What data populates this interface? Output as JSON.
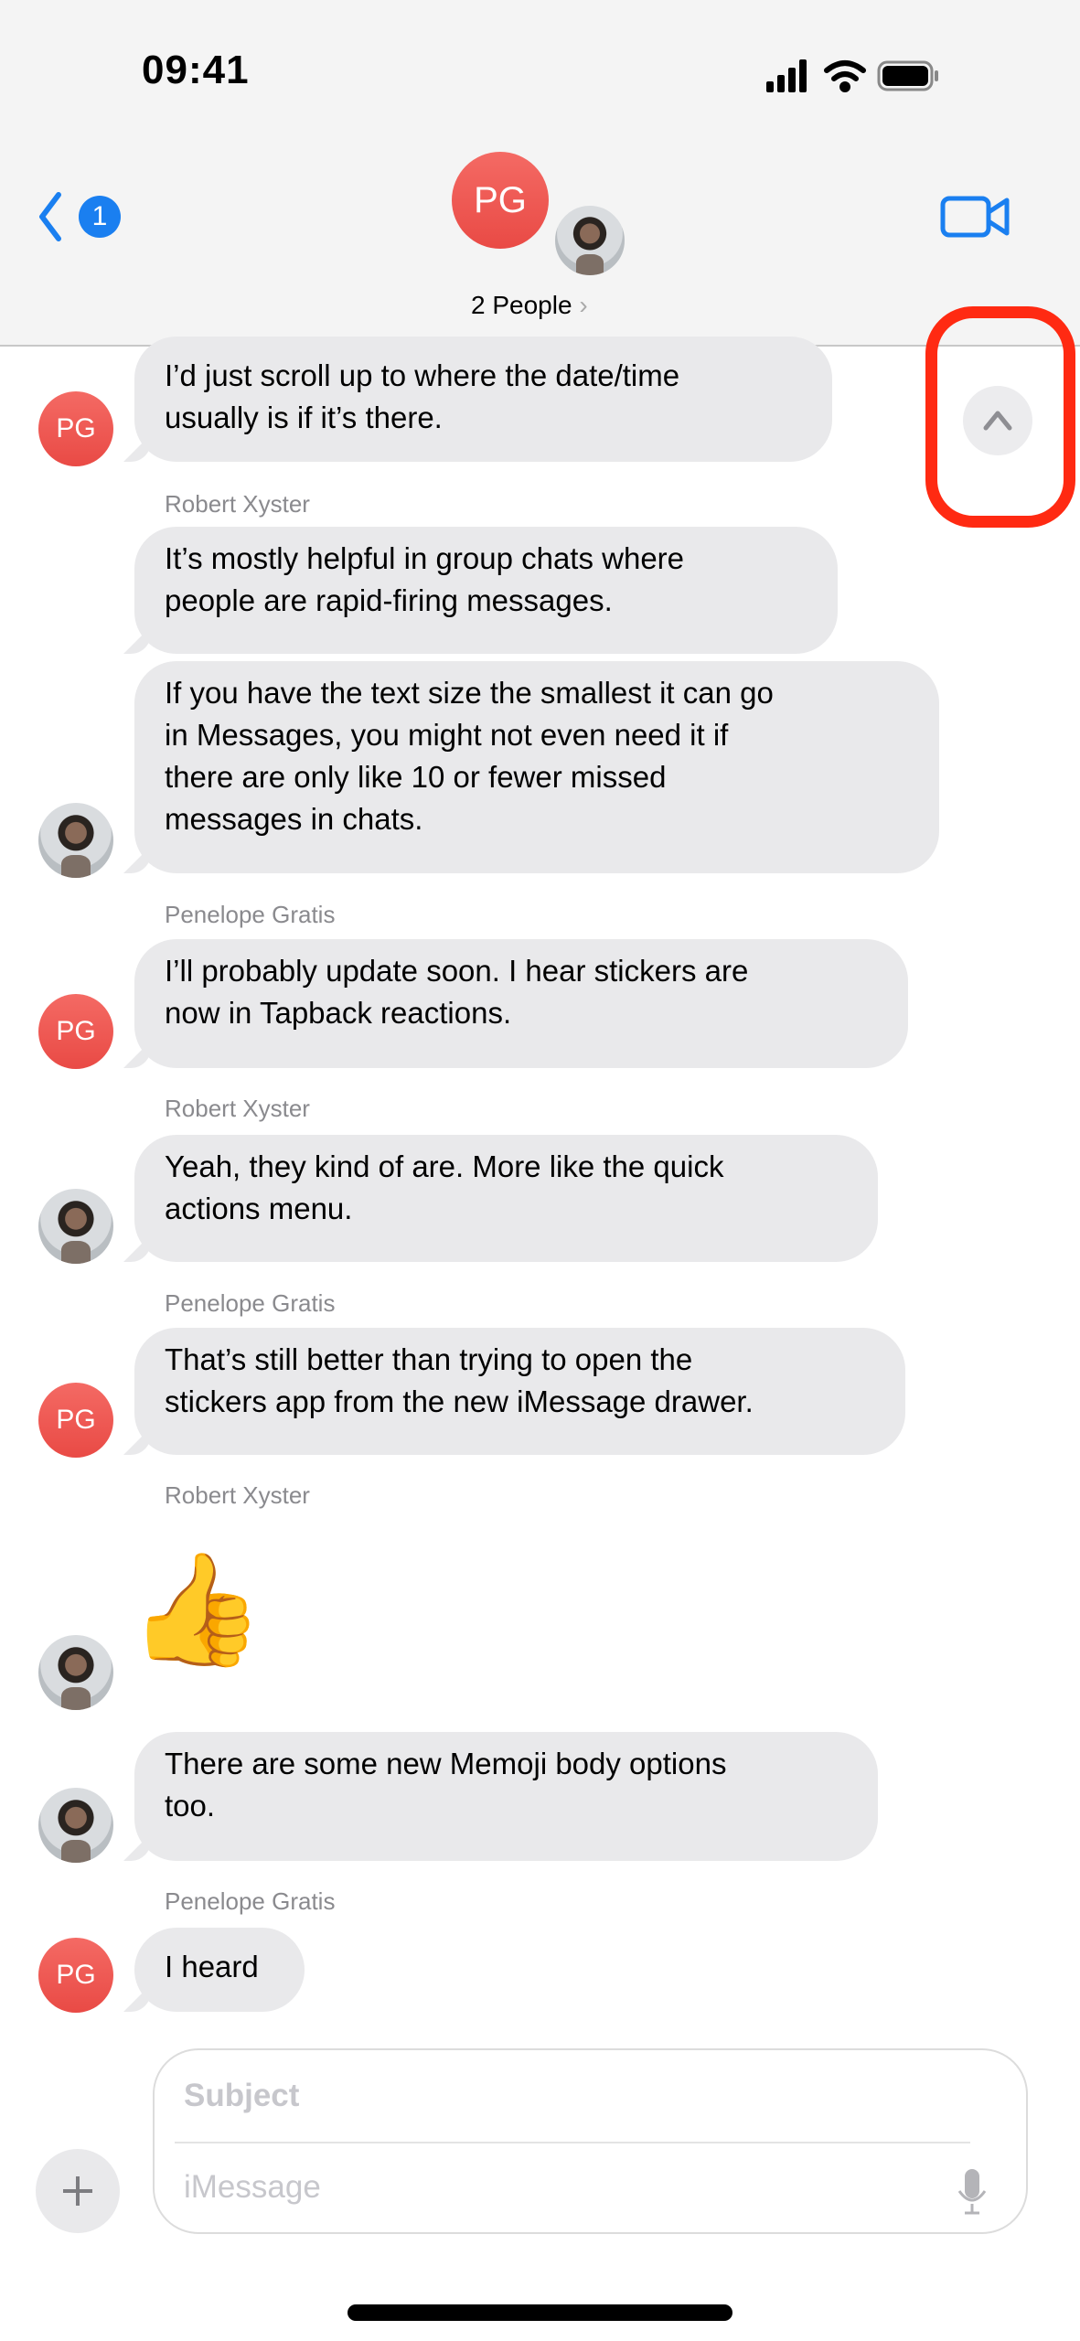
{
  "status_bar": {
    "time": "09:41"
  },
  "header": {
    "back_badge": "1",
    "group_initials": "PG",
    "people_label": "2 People",
    "chevron": "›"
  },
  "scroll_up_button": {
    "icon": "chevron-up-icon",
    "highlight_color": "#ff2a12"
  },
  "colors": {
    "accent": "#1a7ff0",
    "bubble": "#e9e9eb",
    "avatar": "#ee5450"
  },
  "messages": [
    {
      "sender": "",
      "initials": "PG",
      "text": "I’d just scroll up to where the date/time\nusually is if it’s there."
    },
    {
      "sender": "Robert Xyster",
      "text": "It’s mostly helpful in group chats where\npeople are rapid-firing messages."
    },
    {
      "sender": "",
      "text": "If you have the text size the smallest it can go\nin Messages, you might not even need it if\nthere are only like 10 or fewer missed\nmessages in chats."
    },
    {
      "sender": "Penelope Gratis",
      "initials": "PG",
      "text": "I’ll probably update soon. I hear stickers are\nnow in Tapback reactions."
    },
    {
      "sender": "Robert Xyster",
      "text": "Yeah, they kind of are. More like the quick\nactions menu."
    },
    {
      "sender": "Penelope Gratis",
      "initials": "PG",
      "text": "That’s still better than trying to open the\nstickers app from the new iMessage drawer."
    },
    {
      "sender": "Robert Xyster",
      "text": "👍"
    },
    {
      "sender": "",
      "text": "There are some new Memoji body options\ntoo."
    },
    {
      "sender": "Penelope Gratis",
      "initials": "PG",
      "text": "I heard"
    }
  ],
  "composer": {
    "subject_placeholder": "Subject",
    "message_placeholder": "iMessage"
  }
}
